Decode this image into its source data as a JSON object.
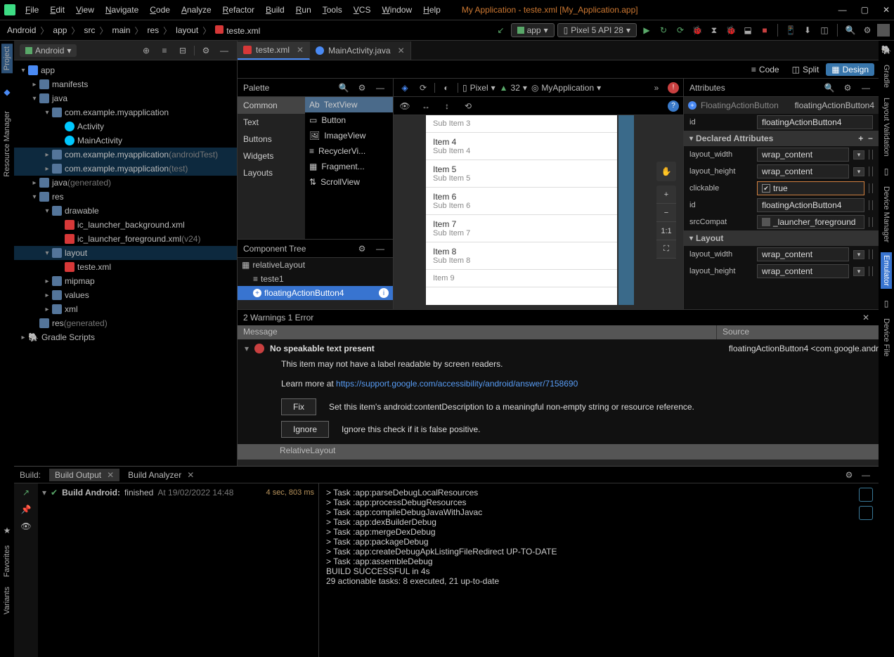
{
  "menubar": {
    "items": [
      "File",
      "Edit",
      "View",
      "Navigate",
      "Code",
      "Analyze",
      "Refactor",
      "Build",
      "Run",
      "Tools",
      "VCS",
      "Window",
      "Help"
    ],
    "title": "My Application - teste.xml [My_Application.app]"
  },
  "breadcrumb": [
    "Android",
    "app",
    "src",
    "main",
    "res",
    "layout",
    "teste.xml"
  ],
  "runConfig": "app",
  "device": "Pixel 5 API 28",
  "leftStrips": [
    "Project",
    "Resource Manager"
  ],
  "leftStrips2": [
    "Favorites",
    "Variants"
  ],
  "rightStrips": [
    "Gradle",
    "Layout Validation",
    "Device Manager",
    "Emulator",
    "Device File"
  ],
  "project": {
    "selector": "Android",
    "tree": {
      "app": "app",
      "manifests": "manifests",
      "java": "java",
      "pkg": "com.example.myapplication",
      "activity": "Activity",
      "mainActivity": "MainActivity",
      "pkgTest": "com.example.myapplication",
      "pkgTestSuffix": "(androidTest)",
      "pkgUnit": "com.example.myapplication",
      "pkgUnitSuffix": "(test)",
      "javaGen": "java",
      "javaGenSuffix": "(generated)",
      "res": "res",
      "drawable": "drawable",
      "icBg": "ic_launcher_background.xml",
      "icFg": "ic_launcher_foreground.xml",
      "icFgSuffix": "(v24)",
      "layout": "layout",
      "testeXml": "teste.xml",
      "mipmap": "mipmap",
      "values": "values",
      "xml": "xml",
      "resGen": "res",
      "resGenSuffix": "(generated)",
      "gradle": "Gradle Scripts"
    }
  },
  "editorTabs": [
    {
      "name": "teste.xml",
      "icon": "xml",
      "active": true
    },
    {
      "name": "MainActivity.java",
      "icon": "java",
      "active": false
    }
  ],
  "viewModes": {
    "code": "Code",
    "split": "Split",
    "design": "Design"
  },
  "palette": {
    "title": "Palette",
    "cats": [
      "Common",
      "Text",
      "Buttons",
      "Widgets",
      "Layouts"
    ],
    "items": [
      "TextView",
      "Button",
      "ImageView",
      "RecyclerVi...",
      "Fragment...",
      "ScrollView"
    ]
  },
  "componentTree": {
    "title": "Component Tree",
    "root": "relativeLayout",
    "child1": "teste1",
    "child2": "floatingActionButton4"
  },
  "canvasBar": {
    "pixel": "Pixel",
    "api": "32",
    "theme": "MyApplication"
  },
  "listItems": [
    {
      "t": "Sub Item 3"
    },
    {
      "t": "Item 4",
      "s": "Sub Item 4"
    },
    {
      "t": "Item 5",
      "s": "Sub Item 5"
    },
    {
      "t": "Item 6",
      "s": "Sub Item 6"
    },
    {
      "t": "Item 7",
      "s": "Sub Item 7"
    },
    {
      "t": "Item 8",
      "s": "Sub Item 8"
    },
    {
      "t": "Item 9"
    }
  ],
  "zoom": {
    "fit": "1:1"
  },
  "attributes": {
    "title": "Attributes",
    "clazz": "FloatingActionButton",
    "instance": "floatingActionButton4",
    "idLabel": "id",
    "idVal": "floatingActionButton4",
    "declared": "Declared Attributes",
    "rows": [
      {
        "n": "layout_width",
        "v": "wrap_content",
        "dd": true
      },
      {
        "n": "layout_height",
        "v": "wrap_content",
        "dd": true
      },
      {
        "n": "clickable",
        "v": "true",
        "hl": true,
        "cb": true
      },
      {
        "n": "id",
        "v": "floatingActionButton4"
      },
      {
        "n": "srcCompat",
        "v": "_launcher_foreground",
        "img": true
      }
    ],
    "layoutSec": "Layout",
    "lrows": [
      {
        "n": "layout_width",
        "v": "wrap_content",
        "dd": true
      },
      {
        "n": "layout_height",
        "v": "wrap_content",
        "dd": true
      }
    ]
  },
  "problems": {
    "summary": "2 Warnings 1 Error",
    "colMsg": "Message",
    "colSrc": "Source",
    "errTitle": "No speakable text present",
    "errSrc": "floatingActionButton4 <com.google.andr",
    "errDesc": "This item may not have a label readable by screen readers.",
    "learnPrefix": "Learn more at ",
    "learnUrl": "https://support.google.com/accessibility/android/answer/7158690",
    "fixBtn": "Fix",
    "fixDesc": "Set this item's android:contentDescription to a meaningful non-empty string or resource reference.",
    "ignoreBtn": "Ignore",
    "ignoreDesc": "Ignore this check if it is false positive.",
    "footer": "RelativeLayout"
  },
  "build": {
    "label": "Build:",
    "tab1": "Build Output",
    "tab2": "Build Analyzer",
    "treeTitle": "Build Android:",
    "treeStatus": "finished",
    "treeTime": "At 19/02/2022 14:48",
    "treeDur": "4 sec, 803 ms",
    "log": [
      "> Task :app:parseDebugLocalResources",
      "> Task :app:processDebugResources",
      "> Task :app:compileDebugJavaWithJavac",
      "> Task :app:dexBuilderDebug",
      "> Task :app:mergeDexDebug",
      "> Task :app:packageDebug",
      "> Task :app:createDebugApkListingFileRedirect UP-TO-DATE",
      "> Task :app:assembleDebug",
      "",
      "BUILD SUCCESSFUL in 4s",
      "29 actionable tasks: 8 executed, 21 up-to-date"
    ]
  }
}
